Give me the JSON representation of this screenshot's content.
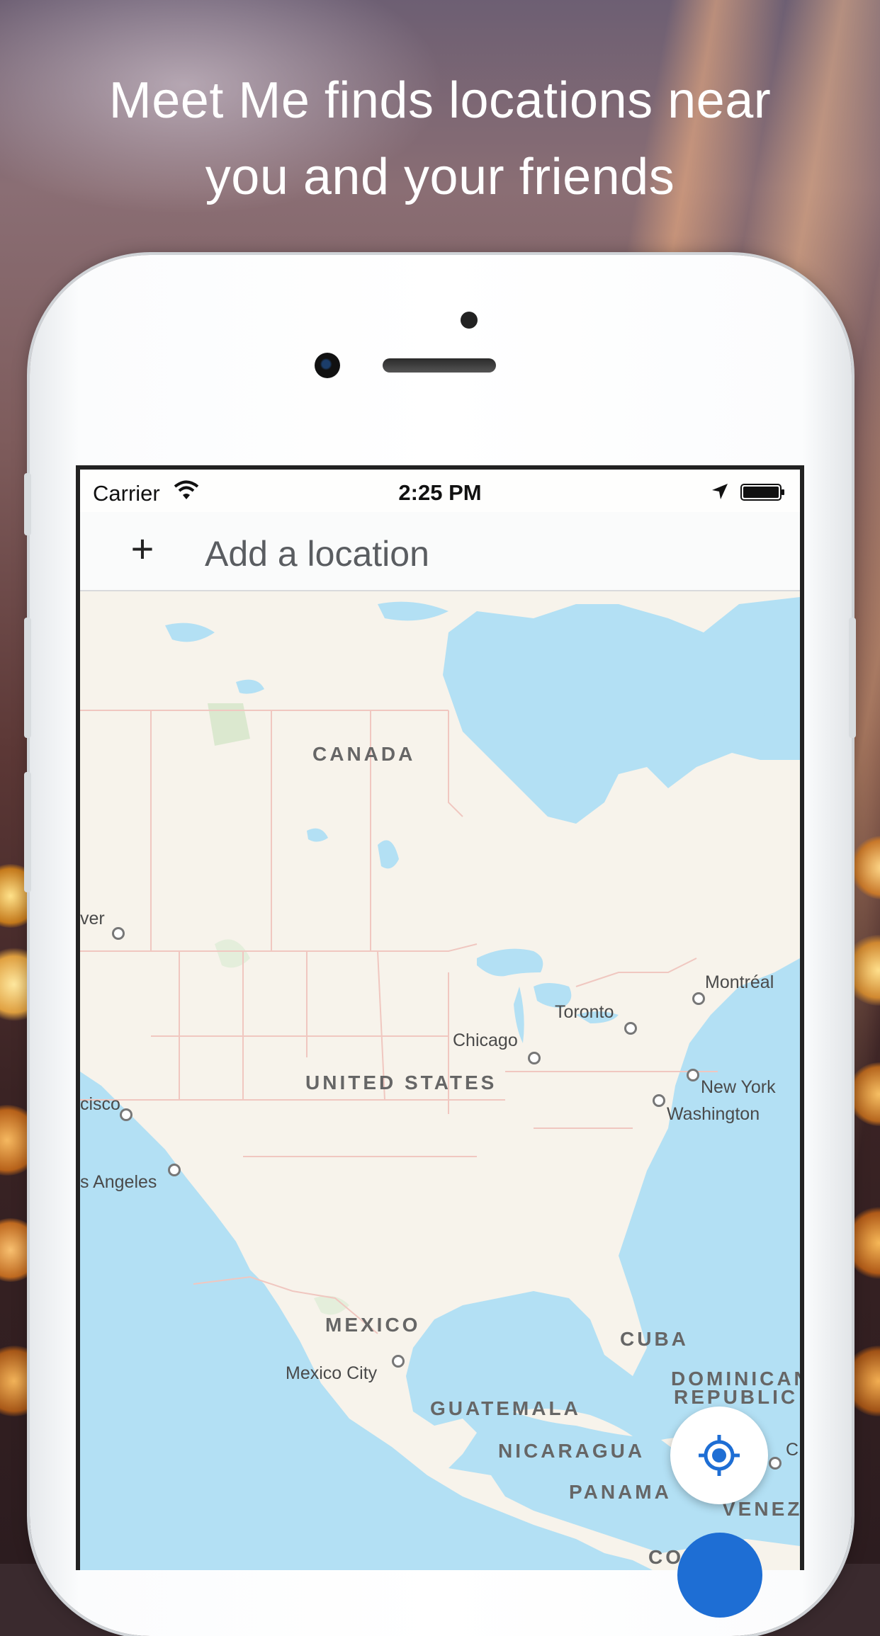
{
  "headline": {
    "line1": "Meet Me finds locations near",
    "line2": "you and your friends"
  },
  "status_bar": {
    "carrier": "Carrier",
    "time": "2:25 PM",
    "icons": [
      "wifi-icon",
      "location-arrow-icon",
      "battery-icon"
    ]
  },
  "search": {
    "add_icon": "plus-icon",
    "placeholder": "Add a location"
  },
  "map": {
    "countries": {
      "canada": "CANADA",
      "united_states": "UNITED STATES",
      "mexico": "MEXICO",
      "cuba": "CUBA",
      "dominican_1": "DOMINICAN",
      "dominican_2": "REPUBLIC",
      "guatemala": "GUATEMALA",
      "nicaragua": "NICARAGUA",
      "panama": "PANAMA",
      "venezuela": "VENEZ",
      "colombia": "CO"
    },
    "cities": {
      "vancouver": "ver",
      "san_francisco": "cisco",
      "los_angeles": "s Angeles",
      "chicago": "Chicago",
      "toronto": "Toronto",
      "montreal": "Montréal",
      "new_york": "New York",
      "washington": "Washington",
      "mexico_city": "Mexico City",
      "caracas": "C"
    },
    "colors": {
      "water": "#b3e0f4",
      "land": "#f7f3eb",
      "border": "#f0c7c0"
    }
  },
  "controls": {
    "locate_icon": "crosshair-icon",
    "fab_color": "#1e6ed4"
  }
}
